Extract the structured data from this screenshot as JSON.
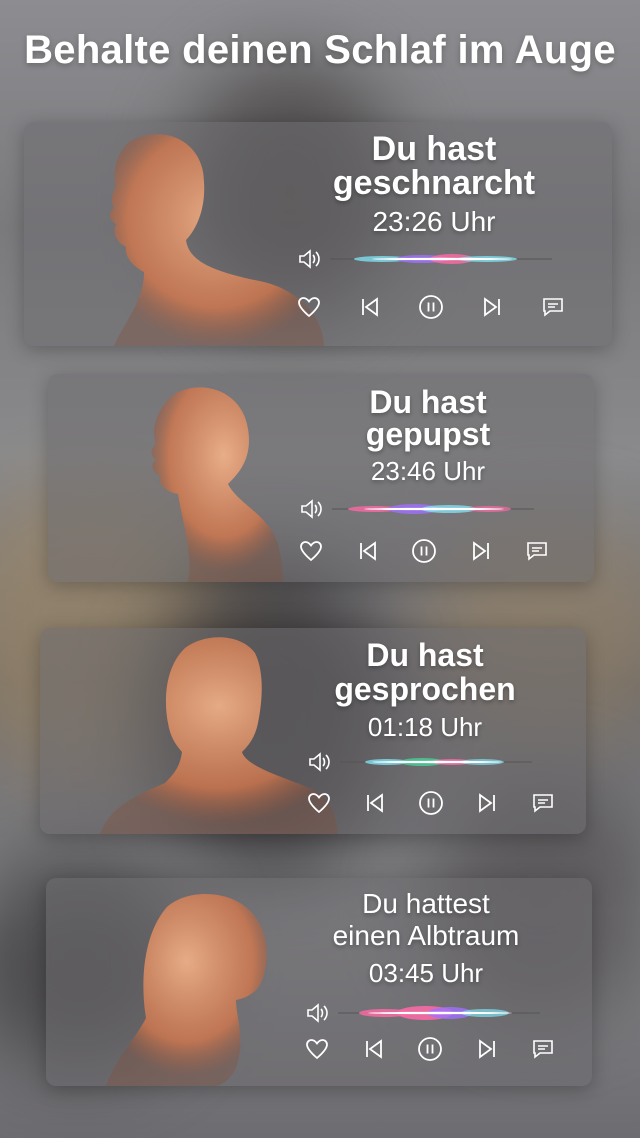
{
  "headline": "Behalte deinen Schlaf im Auge",
  "cards": [
    {
      "title_line1": "Du hast",
      "title_line2": "geschnarcht",
      "time": "23:26 Uhr"
    },
    {
      "title_line1": "Du hast",
      "title_line2": "gepupst",
      "time": "23:46 Uhr"
    },
    {
      "title_line1": "Du hast",
      "title_line2": "gesprochen",
      "time": "01:18 Uhr"
    },
    {
      "title_line1": "Du hattest",
      "title_line2": "einen Albtraum",
      "time": "03:45 Uhr"
    }
  ],
  "icons": [
    "volume-icon",
    "heart-icon",
    "skip-back-icon",
    "pause-icon",
    "skip-forward-icon",
    "comment-icon"
  ],
  "colors": {
    "skin": "#e8935f",
    "wave_cyan": "#7fe0f0",
    "wave_pink": "#ff6aa8",
    "wave_purple": "#a070ff"
  }
}
